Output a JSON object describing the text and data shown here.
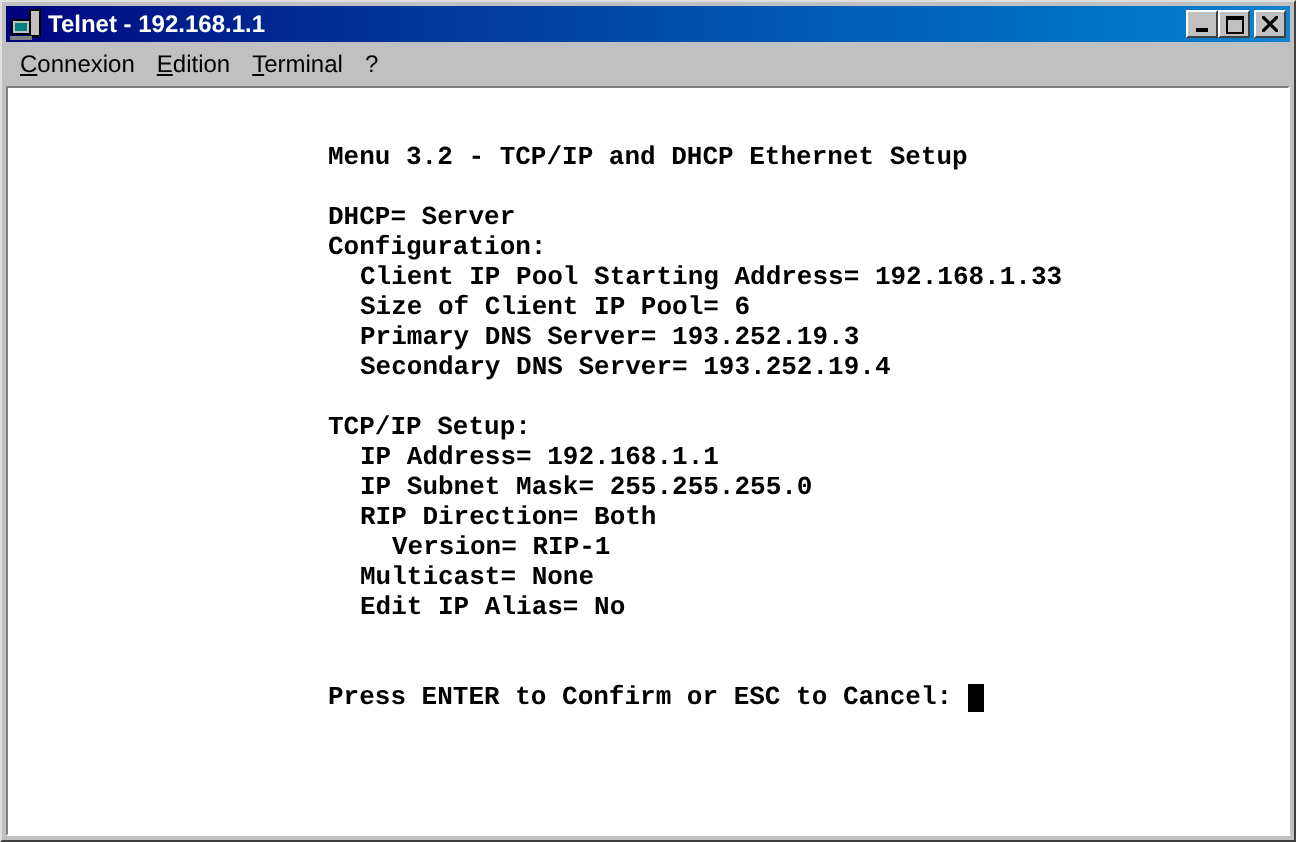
{
  "window": {
    "title": "Telnet - 192.168.1.1"
  },
  "menu": [
    "Connexion",
    "Edition",
    "Terminal",
    "?"
  ],
  "terminal": {
    "heading": "Menu 3.2 - TCP/IP and DHCP Ethernet Setup",
    "blocks": [
      [
        {
          "text": "DHCP= Server"
        },
        {
          "text": "Configuration:",
          "children": [
            {
              "text": "Client IP Pool Starting Address= 192.168.1.33"
            },
            {
              "text": "Size of Client IP Pool= 6"
            },
            {
              "text": "Primary DNS Server= 193.252.19.3"
            },
            {
              "text": "Secondary DNS Server= 193.252.19.4"
            }
          ]
        }
      ],
      [
        {
          "text": "TCP/IP Setup:",
          "children": [
            {
              "text": "IP Address= 192.168.1.1"
            },
            {
              "text": "IP Subnet Mask= 255.255.255.0"
            },
            {
              "text": "RIP Direction= Both",
              "children": [
                {
                  "text": "Version= RIP-1"
                }
              ]
            },
            {
              "text": "Multicast= None"
            },
            {
              "text": "Edit IP Alias= No"
            }
          ]
        }
      ]
    ],
    "prompt": "Press ENTER to Confirm or ESC to Cancel:"
  }
}
